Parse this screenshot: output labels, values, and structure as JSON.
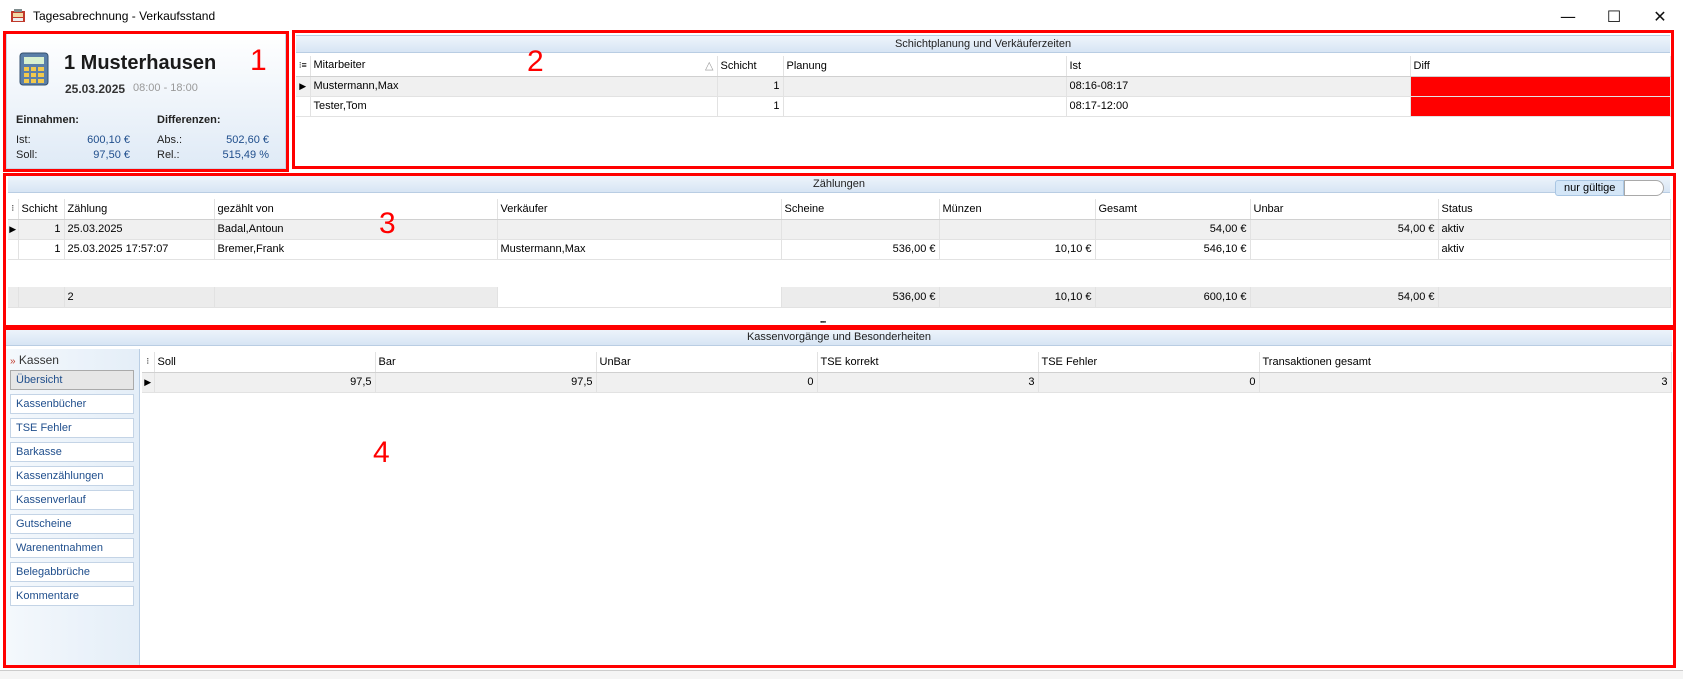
{
  "window": {
    "title": "Tagesabrechnung - Verkaufsstand",
    "minimize": "—",
    "maximize": "☐",
    "close": "✕"
  },
  "annotations": [
    "1",
    "2",
    "3",
    "4"
  ],
  "info": {
    "site": "1 Musterhausen",
    "date": "25.03.2025",
    "hours": "08:00 - 18:00",
    "einnahmen_label": "Einnahmen:",
    "differenzen_label": "Differenzen:",
    "ist_label": "Ist:",
    "ist_value": "600,10 €",
    "soll_label": "Soll:",
    "soll_value": "97,50 €",
    "abs_label": "Abs.:",
    "abs_value": "502,60 €",
    "rel_label": "Rel.:",
    "rel_value": "515,49 %"
  },
  "shifts": {
    "title": "Schichtplanung und Verkäuferzeiten",
    "columns": [
      "Mitarbeiter",
      "Schicht",
      "Planung",
      "Ist",
      "Diff"
    ],
    "rows": [
      {
        "mitarbeiter": "Mustermann,Max",
        "schicht": "1",
        "planung": "",
        "ist": "08:16-08:17",
        "diff": ""
      },
      {
        "mitarbeiter": "Tester,Tom",
        "schicht": "1",
        "planung": "",
        "ist": "08:17-12:00",
        "diff": ""
      }
    ],
    "diff_color": "#ff0000"
  },
  "counts": {
    "title": "Zählungen",
    "filter_label": "nur gültige",
    "columns": [
      "Schicht",
      "Zählung",
      "gezählt von",
      "Verkäufer",
      "Scheine",
      "Münzen",
      "Gesamt",
      "Unbar",
      "Status"
    ],
    "rows": [
      {
        "schicht": "1",
        "zaehlung": "25.03.2025",
        "von": "Badal,Antoun",
        "verkaeufer": "",
        "scheine": "",
        "muenzen": "",
        "gesamt": "54,00 €",
        "unbar": "54,00 €",
        "status": "aktiv"
      },
      {
        "schicht": "1",
        "zaehlung": "25.03.2025 17:57:07",
        "von": "Bremer,Frank",
        "verkaeufer": "Mustermann,Max",
        "scheine": "536,00 €",
        "muenzen": "10,10 €",
        "gesamt": "546,10 €",
        "unbar": "",
        "status": "aktiv"
      }
    ],
    "footer": {
      "count": "2",
      "scheine": "536,00 €",
      "muenzen": "10,10 €",
      "gesamt": "600,10 €",
      "unbar": "54,00 €"
    }
  },
  "kassen": {
    "title": "Kassenvorgänge und Besonderheiten",
    "nav_head": "Kassen",
    "nav_items": [
      "Übersicht",
      "Kassenbücher",
      "TSE Fehler",
      "Barkasse",
      "Kassenzählungen",
      "Kassenverlauf",
      "Gutscheine",
      "Warenentnahmen",
      "Belegabbrüche",
      "Kommentare"
    ],
    "columns": [
      "Soll",
      "Bar",
      "UnBar",
      "TSE korrekt",
      "TSE Fehler",
      "Transaktionen gesamt"
    ],
    "rows": [
      {
        "soll": "97,5",
        "bar": "97,5",
        "unbar": "0",
        "tse_korrekt": "3",
        "tse_fehler": "0",
        "transaktionen": "3"
      }
    ]
  }
}
